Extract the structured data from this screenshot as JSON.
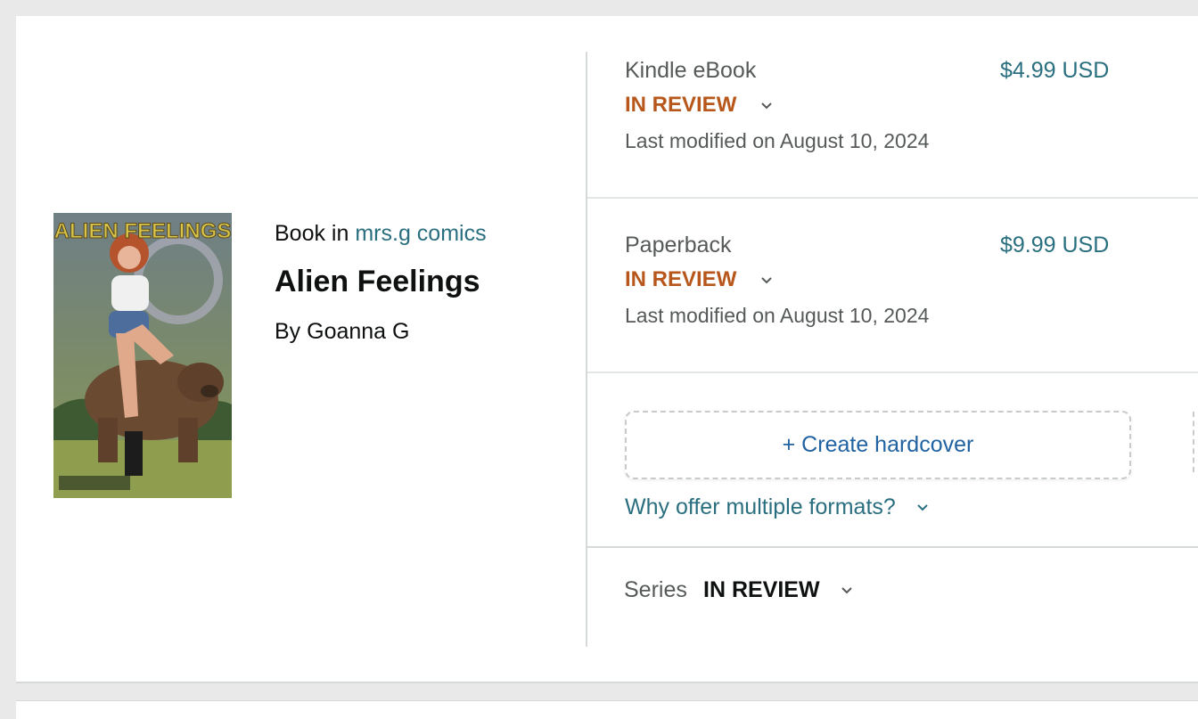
{
  "book": {
    "cover_title_text": "ALIEN FEELINGS",
    "book_in_prefix": "Book in",
    "series_link": "mrs.g comics",
    "title": "Alien Feelings",
    "author": "By Goanna G"
  },
  "formats": [
    {
      "name": "Kindle eBook",
      "price": "$4.99 USD",
      "status": "IN REVIEW",
      "modified": "Last modified on August 10, 2024"
    },
    {
      "name": "Paperback",
      "price": "$9.99 USD",
      "status": "IN REVIEW",
      "modified": "Last modified on August 10, 2024"
    }
  ],
  "create": {
    "label": "+ Create hardcover"
  },
  "why_link": "Why offer multiple formats?",
  "series": {
    "label": "Series",
    "status": "IN REVIEW"
  },
  "colors": {
    "status_orange": "#b7571b",
    "link_teal": "#2a6f7f",
    "button_blue": "#2162a1"
  }
}
